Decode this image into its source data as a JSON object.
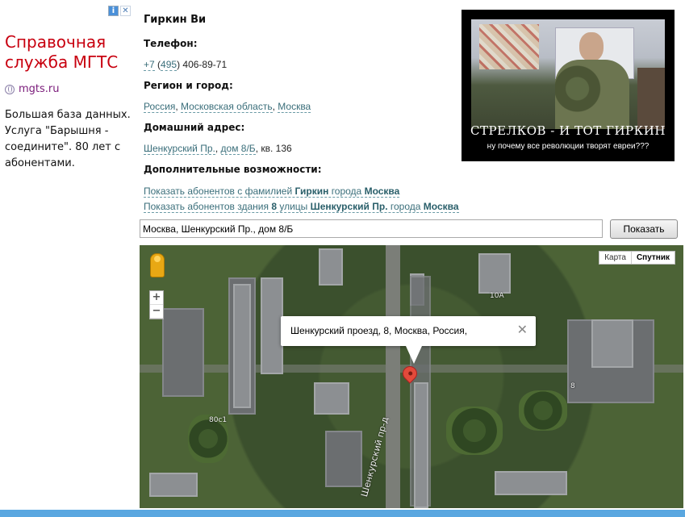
{
  "ad": {
    "info_glyph": "i",
    "close_glyph": "✕",
    "title": "Справочная служба МГТС",
    "domain": "mgts.ru",
    "text": "Большая база данных. Услуга \"Барышня - соедините\". 80 лет с абонентами."
  },
  "person": {
    "name": "Гиркин Ви",
    "phone_label": "Телефон:",
    "phone_country": "+7",
    "phone_code": "495",
    "phone_number": "406-89-71",
    "region_label": "Регион и город:",
    "country": "Россия",
    "region": "Московская область",
    "city": "Москва",
    "address_label": "Домашний адрес:",
    "street": "Шенкурский Пр.",
    "house": "дом 8/Б",
    "apartment": "кв. 136",
    "extra_label": "Дополнительные возможности:",
    "link1_prefix": "Показать абонентов с фамилией",
    "link1_name": "Гиркин",
    "link1_mid": "города",
    "link1_city": "Москва",
    "link2_prefix": "Показать абонентов здания",
    "link2_house": "8",
    "link2_mid": "улицы",
    "link2_street": "Шенкурский Пр.",
    "link2_mid2": "города",
    "link2_city": "Москва"
  },
  "banner": {
    "title": "СТРЕЛКОВ - И ТОТ ГИРКИН",
    "subtitle": "ну почему все революции творят евреи???"
  },
  "search": {
    "value": "Москва, Шенкурский Пр., дом 8/Б",
    "button": "Показать"
  },
  "map": {
    "type_map": "Карта",
    "type_satellite": "Спутник",
    "zoom_in": "+",
    "zoom_out": "−",
    "info_text": "Шенкурский проезд, 8, Москва, Россия,",
    "info_close": "✕",
    "label_street": "Шенкурский пр-д",
    "label_80s1": "80с1",
    "label_10a": "10А",
    "label_8": "8"
  }
}
